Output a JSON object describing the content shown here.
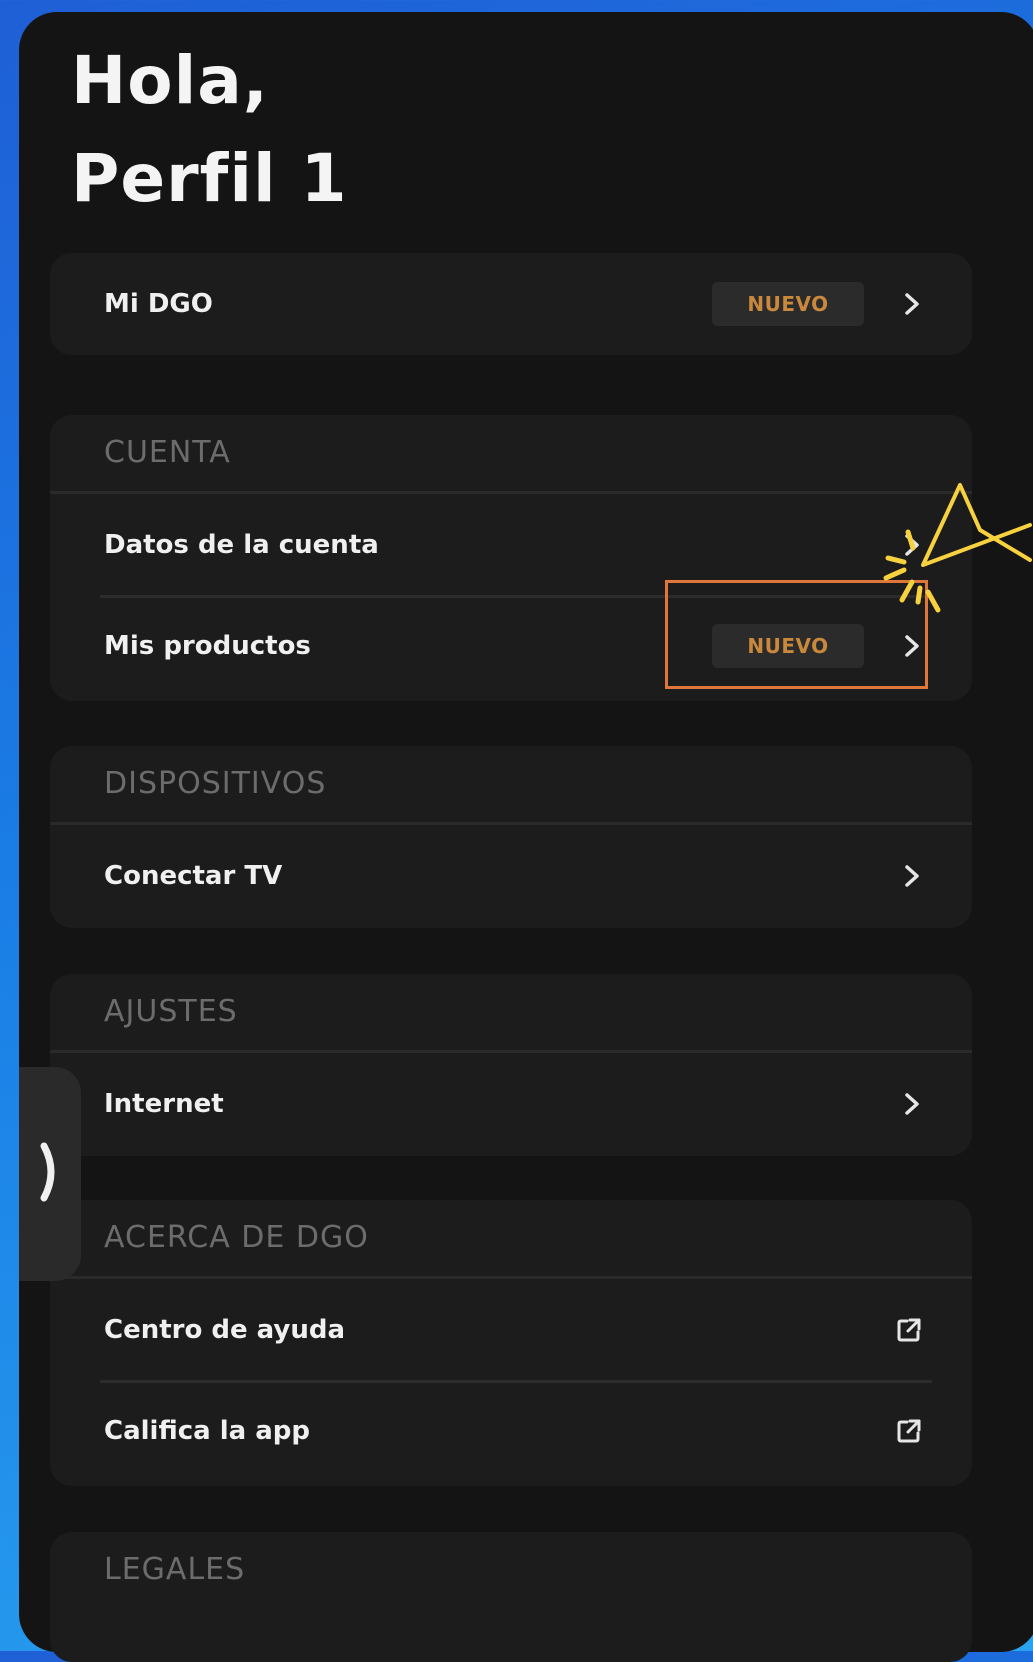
{
  "greeting": {
    "line1": "Hola,",
    "line2": "Perfil 1"
  },
  "colors": {
    "accent_badge": "#c9883c",
    "highlight_box": "#e0773a",
    "sparkle": "#f7d23e"
  },
  "cards": {
    "mi_dgo": {
      "rows": [
        {
          "label": "Mi DGO",
          "badge": "NUEVO",
          "icon": "chevron-right-icon"
        }
      ]
    },
    "cuenta": {
      "header": "CUENTA",
      "rows": [
        {
          "label": "Datos de la cuenta",
          "icon": "chevron-right-icon"
        },
        {
          "label": "Mis productos",
          "badge": "NUEVO",
          "icon": "chevron-right-icon"
        }
      ]
    },
    "dispositivos": {
      "header": "DISPOSITIVOS",
      "rows": [
        {
          "label": "Conectar TV",
          "icon": "chevron-right-icon"
        }
      ]
    },
    "ajustes": {
      "header": "AJUSTES",
      "rows": [
        {
          "label": "Internet",
          "icon": "chevron-right-icon"
        }
      ]
    },
    "acerca": {
      "header": "ACERCA DE DGO",
      "rows": [
        {
          "label": "Centro de ayuda",
          "icon": "external-link-icon"
        },
        {
          "label": "Califica la app",
          "icon": "external-link-icon"
        }
      ]
    },
    "legales": {
      "header": "LEGALES"
    }
  },
  "side_tab": {
    "icon": "chevron-right-icon"
  }
}
